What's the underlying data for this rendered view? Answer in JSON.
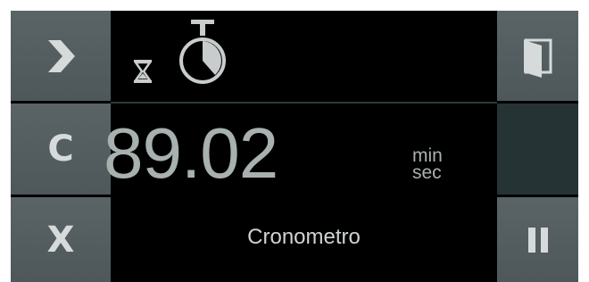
{
  "left_buttons": {
    "next_symbol": ">",
    "clear_label": "C",
    "cancel_label": "X"
  },
  "display": {
    "time_value": "89.02",
    "unit_top": "min",
    "unit_bottom": "sec",
    "mode_label": "Cronometro"
  },
  "icons": {
    "hourglass": "hourglass-icon",
    "stopwatch": "stopwatch-icon",
    "door": "door-icon",
    "pause": "pause-icon"
  },
  "colors": {
    "button": "#525c5e",
    "button_dark": "#263335",
    "display_text": "#a9b0b0",
    "background": "#000000"
  }
}
